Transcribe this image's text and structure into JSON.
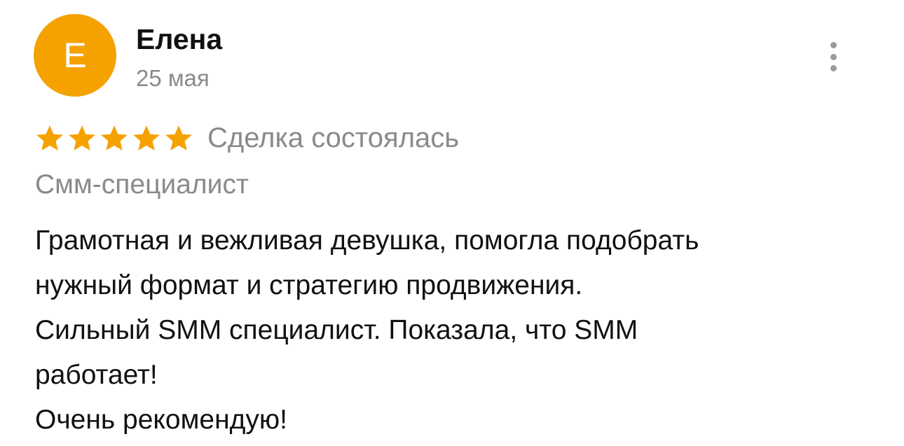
{
  "review": {
    "avatar_letter": "Е",
    "avatar_color": "#f5a200",
    "author_name": "Елена",
    "date": "25 мая",
    "more_icon": "more-vertical-icon",
    "rating": 5,
    "rating_max": 5,
    "star_icon": "star-icon",
    "star_color": "#f5a200",
    "deal_status": "Сделка состоялась",
    "category": "Смм-специалист",
    "text_lines": [
      "Грамотная и вежливая девушка, помогла подобрать",
      "нужный формат и стратегию продвижения.",
      "Сильный SMM специалист.  Показала, что SMM",
      "работает!",
      "Очень рекомендую!"
    ]
  }
}
